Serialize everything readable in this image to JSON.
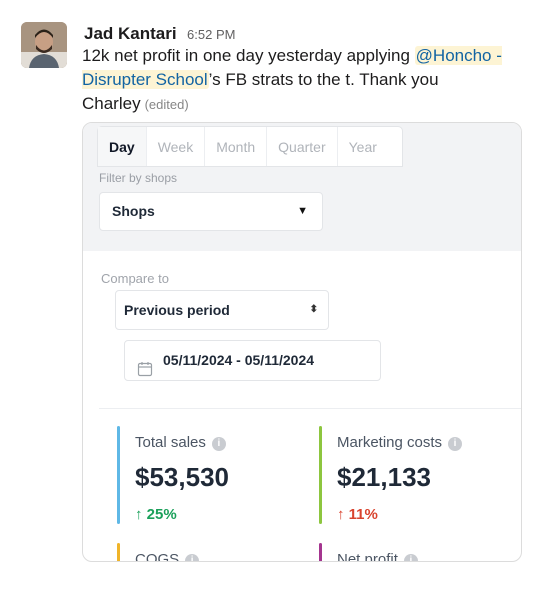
{
  "message": {
    "author": "Jad Kantari",
    "timestamp": "6:52 PM",
    "text_before": "12k net profit in one day yesterday applying ",
    "mention": "@Honcho - Disrupter School",
    "text_after": "’s FB strats to the t. Thank you Charley",
    "edited_label": "(edited)"
  },
  "attachment": {
    "tabs": [
      {
        "label": "Day",
        "active": true
      },
      {
        "label": "Week",
        "active": false
      },
      {
        "label": "Month",
        "active": false
      },
      {
        "label": "Quarter",
        "active": false
      },
      {
        "label": "Year",
        "active": false
      }
    ],
    "filter_label": "Filter by shops",
    "shop_select": {
      "value": "Shops",
      "icon": "chevron-down-icon"
    },
    "compare_label": "Compare to",
    "period_select": {
      "value": "Previous period",
      "icon": "updown-chevron-icon"
    },
    "date_range": {
      "value": "05/11/2024 - 05/11/2024",
      "icon": "calendar-icon"
    },
    "metrics": [
      {
        "label": "Total sales",
        "value": "$53,530",
        "change": "↑ 25%",
        "trend": "up",
        "color": "#5fb8e6"
      },
      {
        "label": "Marketing costs",
        "value": "$21,133",
        "change": "↑ 11%",
        "trend": "down",
        "color": "#8dc63f"
      },
      {
        "label": "COGS",
        "value": "",
        "change": "",
        "trend": "",
        "color": "#f0b429"
      },
      {
        "label": "Net profit",
        "value": "",
        "change": "",
        "trend": "",
        "color": "#a4358f"
      }
    ]
  },
  "colors": {
    "mention_text": "#1264a3",
    "mention_bg": "#fdf4d4",
    "positive": "#1aa05a",
    "negative": "#d9442f"
  }
}
